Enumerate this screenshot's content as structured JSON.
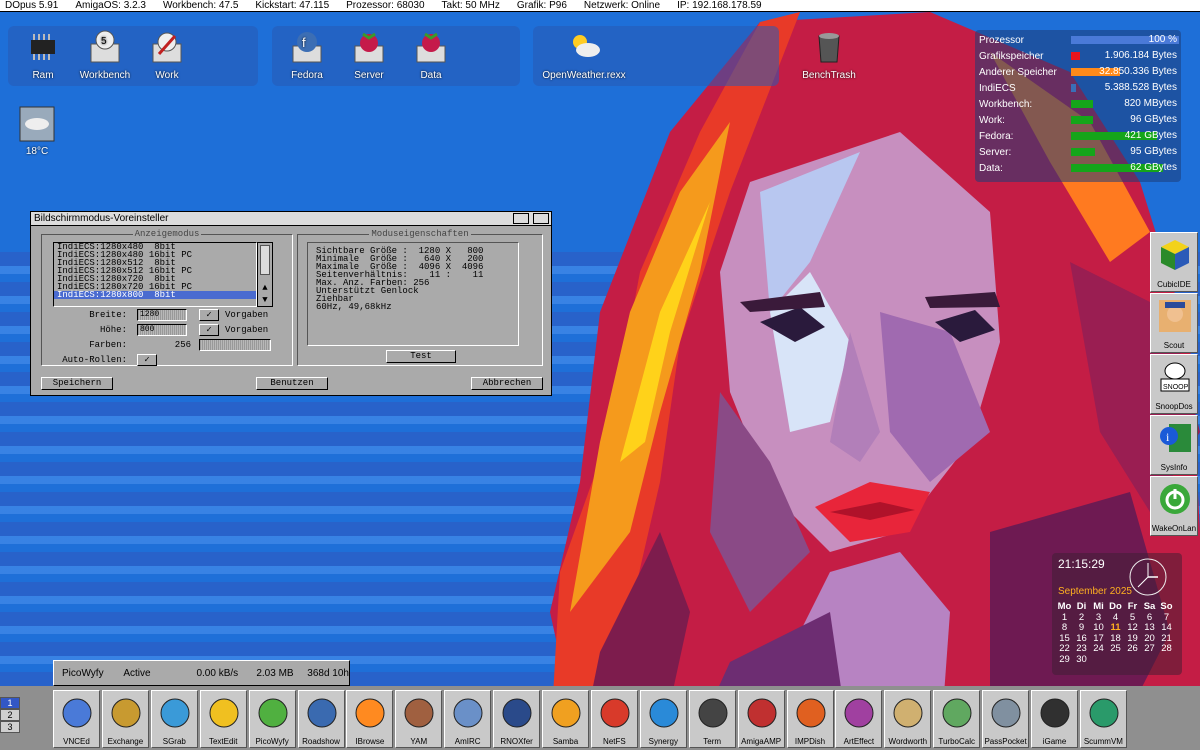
{
  "menubar": {
    "items": [
      "DOpus 5.91",
      "AmigaOS: 3.2.3",
      "Workbench: 47.5",
      "Kickstart: 47.115",
      "Prozessor: 68030",
      "Takt: 50 MHz",
      "Grafik: P96",
      "Netzwerk: Online",
      "IP: 192.168.178.59"
    ]
  },
  "dock_left": {
    "icons": [
      {
        "label": "Ram",
        "icon": "ram-chip-icon"
      },
      {
        "label": "Workbench",
        "icon": "workbench-disk-icon"
      },
      {
        "label": "Work",
        "icon": "work-disk-icon"
      }
    ]
  },
  "dock_mid": {
    "icons": [
      {
        "label": "Fedora",
        "icon": "fedora-drive-icon"
      },
      {
        "label": "Server",
        "icon": "raspberry-drive-icon"
      },
      {
        "label": "Data",
        "icon": "raspberry-drive-icon"
      }
    ]
  },
  "dock_right": {
    "icons": [
      {
        "label": "OpenWeather.rexx",
        "icon": "weather-icon"
      },
      {
        "label": "BenchTrash",
        "icon": "trash-icon"
      }
    ]
  },
  "weather_widget": {
    "label": "18°C",
    "icon": "cloudy-weather-icon"
  },
  "info_panel": {
    "rows": [
      {
        "label": "Prozessor",
        "value": "100 %",
        "fill": 1.0,
        "color": "#4a7ad8"
      },
      {
        "label": "Grafikspeicher",
        "value": "1.906.184 Bytes",
        "fill": 0.08,
        "color": "#e8141c"
      },
      {
        "label": "Anderer Speicher",
        "value": "32.850.336 Bytes",
        "fill": 0.45,
        "color": "#ff8a1a"
      },
      {
        "label": "IndiECS",
        "value": "5.388.528 Bytes",
        "fill": 0.05,
        "color": "#3a6fb8"
      },
      {
        "label": "Workbench:",
        "value": "820 MBytes",
        "fill": 0.2,
        "color": "#15a51a"
      },
      {
        "label": "Work:",
        "value": "96 GBytes",
        "fill": 0.2,
        "color": "#15a51a"
      },
      {
        "label": "Fedora:",
        "value": "421 GBytes",
        "fill": 0.8,
        "color": "#15a51a"
      },
      {
        "label": "Server:",
        "value": "95 GBytes",
        "fill": 0.22,
        "color": "#15a51a"
      },
      {
        "label": "Data:",
        "value": "62 GBytes",
        "fill": 0.85,
        "color": "#15a51a"
      }
    ]
  },
  "prefs_window": {
    "title": "Bildschirmmodus-Voreinsteller",
    "display_group_title": "Anzeigemodus",
    "modes": [
      "IndiECS:1280x480  8bit",
      "IndiECS:1280x480 16bit PC",
      "IndiECS:1280x512  8bit",
      "IndiECS:1280x512 16bit PC",
      "IndiECS:1280x720  8bit",
      "IndiECS:1280x720 16bit PC",
      "IndiECS:1280x800  8bit"
    ],
    "width_label": "Breite:",
    "width_value": "1280",
    "height_label": "Höhe:",
    "height_value": "800",
    "defaults_label": "Vorgaben",
    "colors_label": "Farben:",
    "colors_value": "256",
    "autoscroll_label": "Auto-Rollen:",
    "props_group_title": "Moduseigenschaften",
    "props_lines": [
      "Sichtbare Größe :  1280 X   800",
      "Minimale  Größe :   640 X   200",
      "Maximale  Größe :  4096 X  4096",
      "Seitenverhältnis:    11 :    11",
      "Max. Anz. Farben: 256",
      "",
      "Unterstützt Genlock",
      "Ziehbar",
      "60Hz, 49,68kHz"
    ],
    "test_button": "Test",
    "save_button": "Speichern",
    "use_button": "Benutzen",
    "cancel_button": "Abbrechen"
  },
  "status_strip": {
    "app": "PicoWyfy",
    "state": "Active",
    "rate": "0.00 kB/s",
    "size": "2.03 MB",
    "time": "368d 10h"
  },
  "clock": {
    "time": "21:15:29",
    "month_year": "September 2025",
    "weekdays": [
      "Mo",
      "Di",
      "Mi",
      "Do",
      "Fr",
      "Sa",
      "So"
    ],
    "weeks": [
      [
        "1",
        "2",
        "3",
        "4",
        "5",
        "6",
        "7"
      ],
      [
        "8",
        "9",
        "10",
        "11",
        "12",
        "13",
        "14"
      ],
      [
        "15",
        "16",
        "17",
        "18",
        "19",
        "20",
        "21"
      ],
      [
        "22",
        "23",
        "24",
        "25",
        "26",
        "27",
        "28"
      ],
      [
        "29",
        "30",
        "",
        "",
        "",
        "",
        ""
      ]
    ],
    "today": "11"
  },
  "side_dock": {
    "items": [
      {
        "label": "CubicIDE",
        "icon": "cube-icon"
      },
      {
        "label": "Scout",
        "icon": "scout-icon"
      },
      {
        "label": "SnoopDos",
        "icon": "snoopdos-icon"
      },
      {
        "label": "SysInfo",
        "icon": "sysinfo-icon"
      },
      {
        "label": "WakeOnLan",
        "icon": "power-icon"
      }
    ]
  },
  "screen_numbers": [
    "1",
    "2",
    "3"
  ],
  "bottom_dock": {
    "items": [
      {
        "label": "VNCEd",
        "icon": "vnc-icon"
      },
      {
        "label": "Exchange",
        "icon": "exchange-icon"
      },
      {
        "label": "SGrab",
        "icon": "screengrab-icon"
      },
      {
        "label": "TextEdit",
        "icon": "textedit-icon"
      },
      {
        "label": "PicoWyfy",
        "icon": "wifi-icon"
      },
      {
        "label": "Roadshow",
        "icon": "network-icon"
      },
      {
        "label": "IBrowse",
        "icon": "ibrowse-icon"
      },
      {
        "label": "YAM",
        "icon": "yam-icon"
      },
      {
        "label": "AmIRC",
        "icon": "amirc-icon"
      },
      {
        "label": "RNOXfer",
        "icon": "rno-icon"
      },
      {
        "label": "Samba",
        "icon": "samba-icon"
      },
      {
        "label": "NetFS",
        "icon": "netfs-icon"
      },
      {
        "label": "Synergy",
        "icon": "synergy-icon"
      },
      {
        "label": "Term",
        "icon": "terminal-icon"
      },
      {
        "label": "AmigaAMP",
        "icon": "amigaamp-icon"
      },
      {
        "label": "IMPDish",
        "icon": "impdish-icon"
      },
      {
        "label": "ArtEffect",
        "icon": "arteffect-icon"
      },
      {
        "label": "Wordworth",
        "icon": "wordworth-icon"
      },
      {
        "label": "TurboCalc",
        "icon": "turbocalc-icon"
      },
      {
        "label": "PassPocket",
        "icon": "padlock-icon"
      },
      {
        "label": "iGame",
        "icon": "joystick-icon"
      },
      {
        "label": "ScummVM",
        "icon": "scummvm-icon"
      }
    ]
  }
}
